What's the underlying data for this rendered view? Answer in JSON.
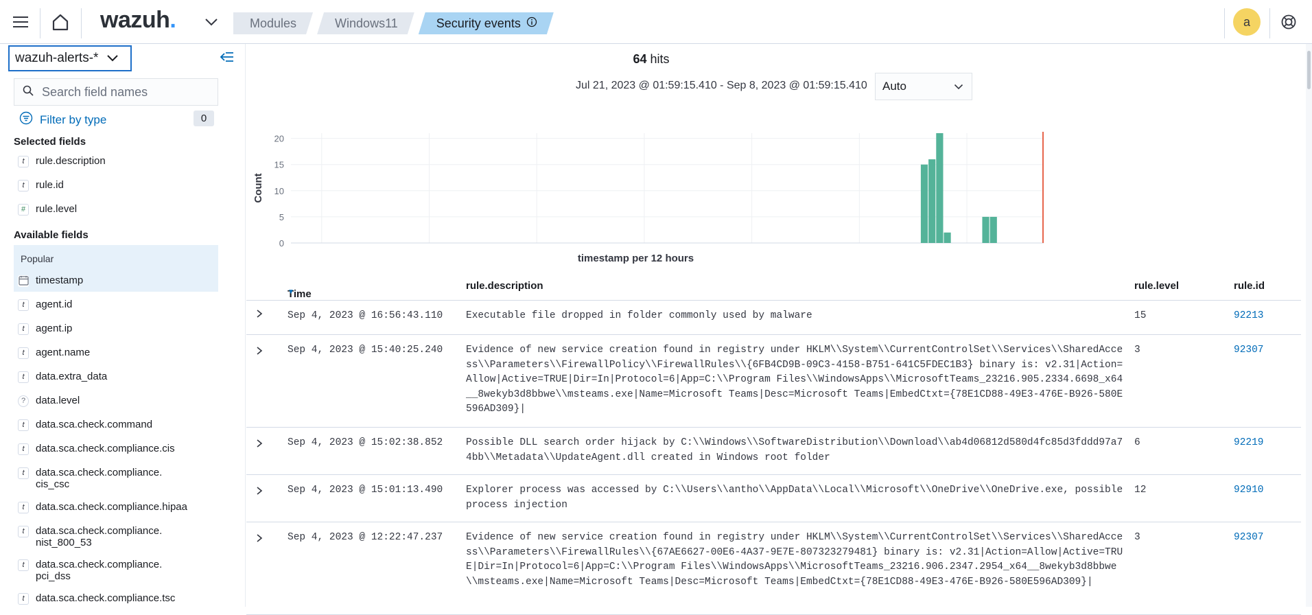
{
  "header": {
    "logo_text": "wazuh",
    "logo_dot": ".",
    "breadcrumbs": [
      "Modules",
      "Windows11",
      "Security events"
    ],
    "avatar_letter": "a",
    "icons": [
      "menu-icon",
      "home-icon",
      "chevron-down-icon",
      "info-icon",
      "help-lifebuoy-icon"
    ]
  },
  "sidebar": {
    "index_pattern": "wazuh-alerts-*",
    "search_placeholder": "Search field names",
    "filter_label": "Filter by type",
    "filter_count": "0",
    "selected_title": "Selected fields",
    "selected_fields": [
      {
        "type": "t",
        "name": "rule.description"
      },
      {
        "type": "t",
        "name": "rule.id"
      },
      {
        "type": "#",
        "name": "rule.level"
      }
    ],
    "available_title": "Available fields",
    "popular_title": "Popular",
    "popular_fields": [
      {
        "type": "date",
        "name": "timestamp"
      }
    ],
    "available_fields": [
      {
        "type": "t",
        "name": "agent.id"
      },
      {
        "type": "t",
        "name": "agent.ip"
      },
      {
        "type": "t",
        "name": "agent.name"
      },
      {
        "type": "t",
        "name": "data.extra_data"
      },
      {
        "type": "?",
        "name": "data.level"
      },
      {
        "type": "t",
        "name": "data.sca.check.command"
      },
      {
        "type": "t",
        "name": "data.sca.check.compliance.cis"
      },
      {
        "type": "t",
        "name": "data.sca.check.compliance.\ncis_csc"
      },
      {
        "type": "t",
        "name": "data.sca.check.compliance.hipaa"
      },
      {
        "type": "t",
        "name": "data.sca.check.compliance.\nnist_800_53"
      },
      {
        "type": "t",
        "name": "data.sca.check.compliance.\npci_dss"
      },
      {
        "type": "t",
        "name": "data.sca.check.compliance.tsc"
      }
    ]
  },
  "main": {
    "hits_count": "64",
    "hits_label": "hits",
    "time_range": "Jul 21, 2023 @ 01:59:15.410 - Sep 8, 2023 @ 01:59:15.410",
    "interval": "Auto"
  },
  "chart_data": {
    "type": "bar",
    "ylabel": "Count",
    "xlabel": "timestamp per 12 hours",
    "ylim": [
      0,
      21
    ],
    "yticks": [
      0,
      5,
      10,
      15,
      20
    ],
    "x_start": "2023-07-21T00:00",
    "x_end": "2023-09-08T00:00",
    "xticks": [
      "2023-07-23 00:00",
      "2023-07-30 00:00",
      "2023-08-06 00:00",
      "2023-08-13 00:00",
      "2023-08-20 00:00",
      "2023-08-27 00:00",
      "2023-09-03 00:00"
    ],
    "bars": [
      {
        "x": "2023-08-31T00:00",
        "value": 15
      },
      {
        "x": "2023-08-31T12:00",
        "value": 16
      },
      {
        "x": "2023-09-01T00:00",
        "value": 21
      },
      {
        "x": "2023-09-01T12:00",
        "value": 2
      },
      {
        "x": "2023-09-04T00:00",
        "value": 5
      },
      {
        "x": "2023-09-04T12:00",
        "value": 5
      }
    ],
    "now_marker": "2023-09-08T00:00",
    "bar_color": "#54b399",
    "marker_color": "#e7664c"
  },
  "table": {
    "columns": {
      "time": "Time",
      "description": "rule.description",
      "level": "rule.level",
      "id": "rule.id"
    },
    "rows": [
      {
        "time": "Sep 4, 2023 @ 16:56:43.110",
        "description": "Executable file dropped in folder commonly used by malware",
        "level": "15",
        "id": "92213"
      },
      {
        "time": "Sep 4, 2023 @ 15:40:25.240",
        "description": "Evidence of new service creation found in registry under HKLM\\\\System\\\\CurrentControlSet\\\\Services\\\\SharedAccess\\\\Parameters\\\\FirewallPolicy\\\\FirewallRules\\\\{6FB4CD9B-09C3-4158-B751-641C5FDEC1B3} binary is: v2.31|Action=Allow|Active=TRUE|Dir=In|Protocol=6|App=C:\\\\Program Files\\\\WindowsApps\\\\MicrosoftTeams_23216.905.2334.6698_x64__8wekyb3d8bbwe\\\\msteams.exe|Name=Microsoft Teams|Desc=Microsoft Teams|EmbedCtxt={78E1CD88-49E3-476E-B926-580E596AD309}|",
        "level": "3",
        "id": "92307"
      },
      {
        "time": "Sep 4, 2023 @ 15:02:38.852",
        "description": "Possible DLL search order hijack by C:\\\\Windows\\\\SoftwareDistribution\\\\Download\\\\ab4d06812d580d4fc85d3fddd97a74bb\\\\Metadata\\\\UpdateAgent.dll created in Windows root folder",
        "level": "6",
        "id": "92219"
      },
      {
        "time": "Sep 4, 2023 @ 15:01:13.490",
        "description": "Explorer process was accessed by C:\\\\Users\\\\antho\\\\AppData\\\\Local\\\\Microsoft\\\\OneDrive\\\\OneDrive.exe, possible process injection",
        "level": "12",
        "id": "92910"
      },
      {
        "time": "Sep 4, 2023 @ 12:22:47.237",
        "description": "Evidence of new service creation found in registry under HKLM\\\\System\\\\CurrentControlSet\\\\Services\\\\SharedAccess\\\\Parameters\\\\FirewallRules\\\\{67AE6627-00E6-4A37-9E7E-807323279481} binary is: v2.31|Action=Allow|Active=TRUE|Dir=In|Protocol=6|App=C:\\\\Program Files\\\\WindowsApps\\\\MicrosoftTeams_23216.906.2347.2954_x64__8wekyb3d8bbwe\\\\msteams.exe|Name=Microsoft Teams|Desc=Microsoft Teams|EmbedCtxt={78E1CD88-49E3-476E-B926-580E596AD309}|",
        "level": "3",
        "id": "92307"
      }
    ]
  }
}
